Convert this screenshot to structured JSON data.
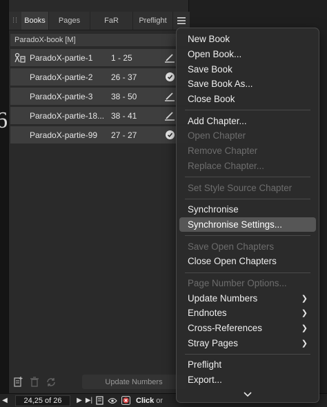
{
  "canvas": {
    "glyph": "6"
  },
  "panel": {
    "tabs": [
      {
        "label": "Books",
        "active": true
      },
      {
        "label": "Pages",
        "active": false
      },
      {
        "label": "FaR",
        "active": false
      },
      {
        "label": "Preflight",
        "active": false
      }
    ],
    "book_title": "ParadoX-book [M]",
    "chapters": [
      {
        "name": "ParadoX-partie-1",
        "range": "1 - 25",
        "lead_icon": "book-source-icon",
        "status_icon": "pen-edit-icon"
      },
      {
        "name": "ParadoX-partie-2",
        "range": "26 - 37",
        "lead_icon": "",
        "status_icon": "check-circle-icon"
      },
      {
        "name": "ParadoX-partie-3",
        "range": "38 - 50",
        "lead_icon": "",
        "status_icon": "pen-edit-icon"
      },
      {
        "name": "ParadoX-partie-18...",
        "range": "38 - 41",
        "lead_icon": "",
        "status_icon": "pen-edit-icon"
      },
      {
        "name": "ParadoX-partie-99",
        "range": "27 - 27",
        "lead_icon": "",
        "status_icon": "check-circle-icon"
      }
    ],
    "update_numbers_label": "Update Numbers"
  },
  "statusbar": {
    "page_label": "24,25 of 26",
    "click_label": "Click",
    "rest_label": "or"
  },
  "menu": {
    "items": [
      {
        "label": "New Book",
        "disabled": false
      },
      {
        "label": "Open Book...",
        "disabled": false
      },
      {
        "label": "Save Book",
        "disabled": false
      },
      {
        "label": "Save Book As...",
        "disabled": false
      },
      {
        "label": "Close Book",
        "disabled": false
      },
      {
        "label": "Add Chapter...",
        "disabled": false
      },
      {
        "label": "Open Chapter",
        "disabled": true
      },
      {
        "label": "Remove Chapter",
        "disabled": true
      },
      {
        "label": "Replace Chapter...",
        "disabled": true
      },
      {
        "label": "Set Style Source Chapter",
        "disabled": true
      },
      {
        "label": "Synchronise",
        "disabled": false
      },
      {
        "label": "Synchronise Settings...",
        "disabled": false,
        "highlighted": true
      },
      {
        "label": "Save Open Chapters",
        "disabled": true
      },
      {
        "label": "Close Open Chapters",
        "disabled": false
      },
      {
        "label": "Page Number Options...",
        "disabled": true
      },
      {
        "label": "Update Numbers",
        "disabled": false,
        "submenu": true
      },
      {
        "label": "Endnotes",
        "disabled": false,
        "submenu": true
      },
      {
        "label": "Cross-References",
        "disabled": false,
        "submenu": true
      },
      {
        "label": "Stray Pages",
        "disabled": false,
        "submenu": true
      },
      {
        "label": "Preflight",
        "disabled": false
      },
      {
        "label": "Export...",
        "disabled": false
      }
    ],
    "colors": {
      "highlight": "#565656",
      "disabled_text": "#6d6d6d"
    }
  }
}
